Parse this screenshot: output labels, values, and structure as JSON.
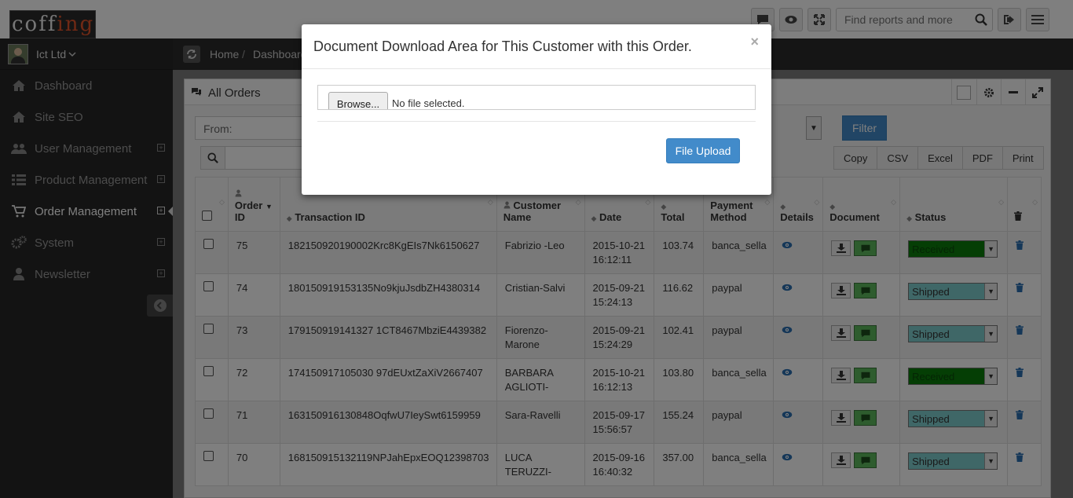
{
  "brand": {
    "logo_text_a": "coff",
    "logo_text_b": "ing"
  },
  "topbar": {
    "search_placeholder": "Find reports and more"
  },
  "sidebar": {
    "profile": "Ict Ltd",
    "items": [
      {
        "label": "Dashboard",
        "icon": "home-icon",
        "expandable": false
      },
      {
        "label": "Site SEO",
        "icon": "home-icon",
        "expandable": false
      },
      {
        "label": "User Management",
        "icon": "users-icon",
        "expandable": true
      },
      {
        "label": "Product Management",
        "icon": "list-icon",
        "expandable": true
      },
      {
        "label": "Order Management",
        "icon": "cart-icon",
        "expandable": true,
        "active": true
      },
      {
        "label": "System",
        "icon": "cogs-icon",
        "expandable": true
      },
      {
        "label": "Newsletter",
        "icon": "user-icon",
        "expandable": true
      }
    ]
  },
  "breadcrumb": {
    "home": "Home",
    "separator": "/",
    "current": "Dashboard"
  },
  "panel": {
    "title": "All Orders"
  },
  "filters": {
    "from_placeholder": "From:",
    "filter_label": "Filter"
  },
  "export": [
    "Copy",
    "CSV",
    "Excel",
    "PDF",
    "Print"
  ],
  "table": {
    "headers": {
      "order_id_a": "Order",
      "order_id_b": "ID",
      "transaction": "Transaction ID",
      "customer_a": "Customer",
      "customer_b": "Name",
      "date": "Date",
      "total": "Total",
      "payment_a": "Payment",
      "payment_b": "Method",
      "details": "Details",
      "document": "Document",
      "status": "Status"
    },
    "rows": [
      {
        "id": "75",
        "txn": "182150920190002Krc8KgEIs7Nk6150627",
        "customer": "Fabrizio -Leo",
        "date": "2015-10-21",
        "time": "16:12:11",
        "total": "103.74",
        "method": "banca_sella",
        "status": "Received"
      },
      {
        "id": "74",
        "txn": "180150919153135No9kjuJsdbZH4380314",
        "customer": "Cristian-Salvi",
        "date": "2015-09-21",
        "time": "15:24:13",
        "total": "116.62",
        "method": "paypal",
        "status": "Shipped"
      },
      {
        "id": "73",
        "txn": "179150919141327 1CT8467MbziE4439382",
        "customer": "Fiorenzo-Marone",
        "date": "2015-09-21",
        "time": "15:24:29",
        "total": "102.41",
        "method": "paypal",
        "status": "Shipped"
      },
      {
        "id": "72",
        "txn": "174150917105030 97dEUxtZaXiV2667407",
        "customer": "BARBARA AGLIOTI-",
        "date": "2015-10-21",
        "time": "16:12:13",
        "total": "103.80",
        "method": "banca_sella",
        "status": "Received"
      },
      {
        "id": "71",
        "txn": "163150916130848OqfwU7IeySwt6159959",
        "customer": "Sara-Ravelli",
        "date": "2015-09-17",
        "time": "15:56:57",
        "total": "155.24",
        "method": "paypal",
        "status": "Shipped"
      },
      {
        "id": "70",
        "txn": "168150915132119NPJahEpxEOQ12398703",
        "customer": "LUCA TERUZZI-",
        "date": "2015-09-16",
        "time": "16:40:32",
        "total": "357.00",
        "method": "banca_sella",
        "status": "Shipped"
      }
    ]
  },
  "modal": {
    "title": "Document Download Area for This Customer with this Order.",
    "close": "×",
    "browse": "Browse...",
    "file_status": "No file selected.",
    "upload": "File Upload"
  },
  "colors": {
    "primary": "#428bca",
    "sidebar": "#262626",
    "received": "#0a7d0a",
    "shipped": "#7fcfcf"
  }
}
